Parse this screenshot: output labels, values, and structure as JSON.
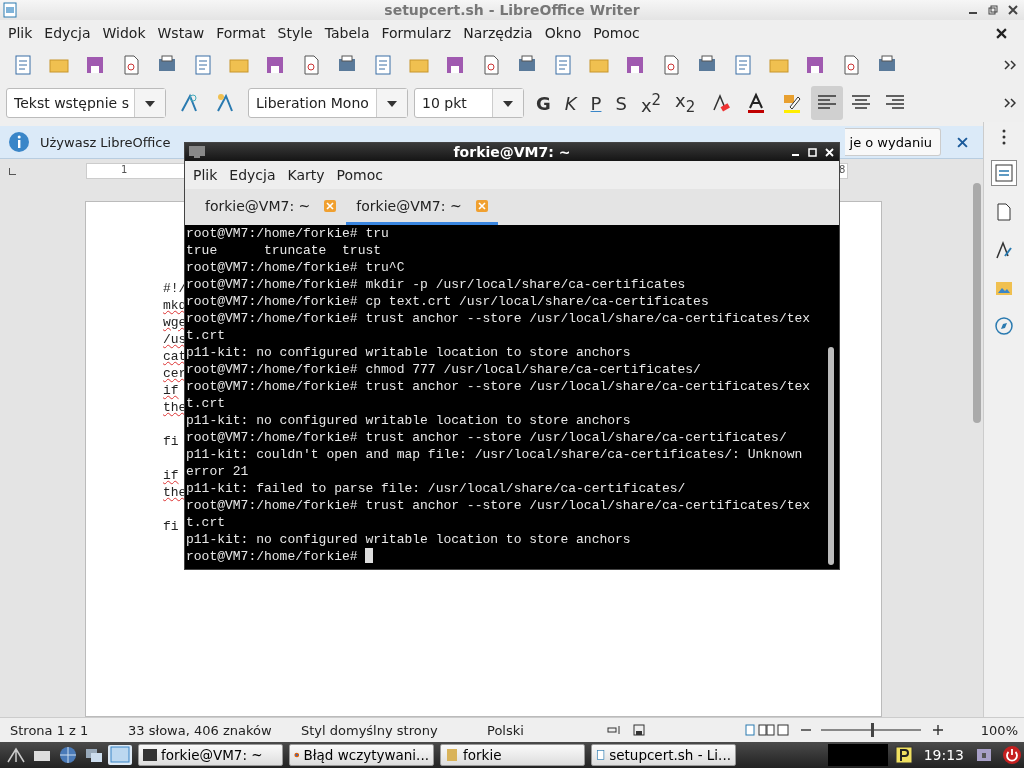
{
  "writer": {
    "title": "setupcert.sh - LibreOffice Writer",
    "menu": [
      "Plik",
      "Edycja",
      "Widok",
      "Wstaw",
      "Format",
      "Style",
      "Tabela",
      "Formularz",
      "Narzędzia",
      "Okno",
      "Pomoc"
    ],
    "paragraph_style": "Tekst wstępnie s",
    "font_name": "Liberation Mono",
    "font_size": "10 pkt",
    "format_buttons": [
      {
        "label": "G",
        "kind": "bold"
      },
      {
        "label": "K",
        "kind": "italic"
      },
      {
        "label": "P",
        "kind": "underline"
      },
      {
        "label": "S",
        "kind": "strike"
      },
      {
        "label": "x$^{2}$",
        "kind": "script"
      },
      {
        "label": "x$_{2}$",
        "kind": "script"
      }
    ],
    "align_buttons": [
      {
        "selected": true
      },
      {
        "selected": false
      },
      {
        "selected": false
      }
    ]
  },
  "infobar": {
    "text": "Używasz LibreOffice",
    "button": "je o wydaniu"
  },
  "ruler": [
    "1",
    "8"
  ],
  "document_lines": [
    {
      "kind": "line",
      "text": "#!/",
      "misspelled": false
    },
    {
      "kind": "line",
      "text": "mkd",
      "misspelled": true
    },
    {
      "kind": "line",
      "text": "wge",
      "misspelled": true
    },
    {
      "kind": "line",
      "text": "/us",
      "misspelled": true
    },
    {
      "kind": "line",
      "text": "cat",
      "misspelled": true
    },
    {
      "kind": "line",
      "text": "cer",
      "misspelled": true
    },
    {
      "kind": "line",
      "text": "if",
      "misspelled": true
    },
    {
      "kind": "line",
      "text": "the",
      "misspelled": true
    },
    {
      "kind": "blank"
    },
    {
      "kind": "line",
      "text": "fi",
      "misspelled": false
    },
    {
      "kind": "blank"
    },
    {
      "kind": "line",
      "text": "if",
      "misspelled": true
    },
    {
      "kind": "line",
      "text": "the",
      "misspelled": true
    },
    {
      "kind": "blank"
    },
    {
      "kind": "line",
      "text": "fi",
      "misspelled": false
    }
  ],
  "status_bar": {
    "page": "Strona 1 z 1",
    "words": "33 słowa, 406 znaków",
    "page_style": "Styl domyślny strony",
    "language": "Polski",
    "zoom_slider": {
      "level": 0.5
    },
    "zoom": "100%"
  },
  "terminal": {
    "title": "forkie@VM7: ~",
    "menu": [
      "Plik",
      "Edycja",
      "Karty",
      "Pomoc"
    ],
    "tabs": [
      {
        "label": "forkie@VM7: ~",
        "selected": false
      },
      {
        "label": "forkie@VM7: ~",
        "selected": true
      }
    ],
    "lines": [
      "root@VM7:/home/forkie# tru",
      "true      truncate  trust",
      "root@VM7:/home/forkie# tru^C",
      "root@VM7:/home/forkie# mkdir -p /usr/local/share/ca-certificates",
      "root@VM7:/home/forkie# cp text.crt /usr/local/share/ca-certificates",
      "root@VM7:/home/forkie# trust anchor --store /usr/local/share/ca-certificates/tex",
      "t.crt",
      "p11-kit: no configured writable location to store anchors",
      "root@VM7:/home/forkie# chmod 777 /usr/local/share/ca-certificates/",
      "root@VM7:/home/forkie# trust anchor --store /usr/local/share/ca-certificates/tex",
      "t.crt",
      "p11-kit: no configured writable location to store anchors",
      "root@VM7:/home/forkie# trust anchor --store /usr/local/share/ca-certificates/",
      "p11-kit: couldn't open and map file: /usr/local/share/ca-certificates/: Unknown",
      "error 21",
      "p11-kit: failed to parse file: /usr/local/share/ca-certificates/",
      "root@VM7:/home/forkie# trust anchor --store /usr/local/share/ca-certificates/tex",
      "t.crt",
      "p11-kit: no configured writable location to store anchors",
      "root@VM7:/home/forkie# "
    ],
    "cursor": true
  },
  "taskbar": {
    "tasks": [
      {
        "kind": "terminal",
        "label": "forkie@VM7: ~",
        "selected": false
      },
      {
        "kind": "browser",
        "label": "Błąd wczytywani...",
        "selected": false
      },
      {
        "kind": "folder",
        "label": "forkie",
        "selected": false
      },
      {
        "kind": "document",
        "label": "setupcert.sh - Li...",
        "selected": false
      }
    ],
    "clock": "19:13"
  }
}
